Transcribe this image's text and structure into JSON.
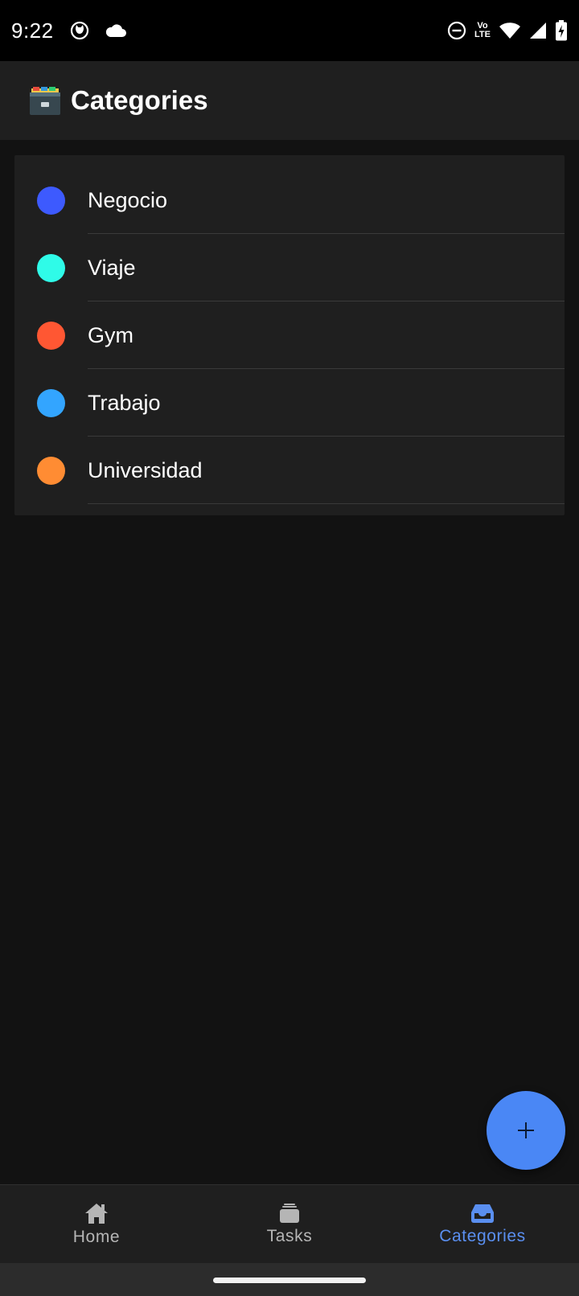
{
  "status_bar": {
    "time": "9:22",
    "lte_top": "Vo",
    "lte_bottom": "LTE"
  },
  "app_bar": {
    "icon": "card-file-box-icon",
    "title": "Categories"
  },
  "categories": [
    {
      "label": "Negocio",
      "color": "#3d5afe"
    },
    {
      "label": "Viaje",
      "color": "#2ffbe8"
    },
    {
      "label": "Gym",
      "color": "#ff5733"
    },
    {
      "label": "Trabajo",
      "color": "#33a5ff"
    },
    {
      "label": "Universidad",
      "color": "#ff8c33"
    }
  ],
  "fab": {
    "icon": "plus-icon"
  },
  "bottom_nav": {
    "items": [
      {
        "label": "Home",
        "icon": "home-icon",
        "active": false
      },
      {
        "label": "Tasks",
        "icon": "stacked-layers-icon",
        "active": false
      },
      {
        "label": "Categories",
        "icon": "inbox-tray-icon",
        "active": true
      }
    ],
    "active_color": "#5a8ff0",
    "inactive_color": "#b5b5b5"
  }
}
